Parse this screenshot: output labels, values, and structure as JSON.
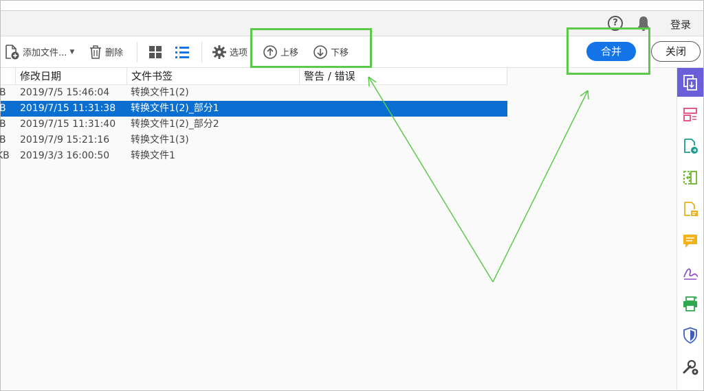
{
  "header": {
    "login_label": "登录",
    "help_symbol": "?",
    "icons": [
      "help-icon",
      "bell-icon"
    ]
  },
  "toolbar": {
    "add_files_label": "添加文件...",
    "delete_label": "删除",
    "options_label": "选项",
    "move_up_label": "上移",
    "move_down_label": "下移",
    "merge_label": "合并",
    "close_label": "关闭",
    "view_modes": [
      "grid-view-icon",
      "list-view-icon"
    ]
  },
  "table": {
    "columns": [
      "修改日期",
      "文件书签",
      "警告 / 错误"
    ],
    "rows": [
      {
        "size_tail": "B",
        "date": "2019/7/5 15:46:04",
        "bookmark": "转换文件1(2)",
        "warning": "",
        "selected": false
      },
      {
        "size_tail": "B",
        "date": "2019/7/15 11:31:38",
        "bookmark": "转换文件1(2)_部分1",
        "warning": "",
        "selected": true
      },
      {
        "size_tail": "B",
        "date": "2019/7/15 11:31:40",
        "bookmark": "转换文件1(2)_部分2",
        "warning": "",
        "selected": false
      },
      {
        "size_tail": "B",
        "date": "2019/7/9 15:21:16",
        "bookmark": "转换文件1(3)",
        "warning": "",
        "selected": false
      },
      {
        "size_tail": "KB",
        "date": "2019/3/3 16:00:50",
        "bookmark": "转换文件1",
        "warning": "",
        "selected": false
      }
    ]
  },
  "right_sidebar": {
    "tools": [
      "combine-files-icon",
      "organize-pages-icon",
      "export-pdf-icon",
      "compress-pdf-icon",
      "edit-pdf-icon",
      "comment-icon",
      "fill-sign-icon",
      "print-production-icon",
      "protect-icon",
      "more-tools-icon"
    ]
  },
  "colors": {
    "accent_blue": "#1473e6",
    "selection_blue": "#0a6fd1",
    "annotation_green": "#5cc94a",
    "active_tool": "#6a5fd8"
  }
}
